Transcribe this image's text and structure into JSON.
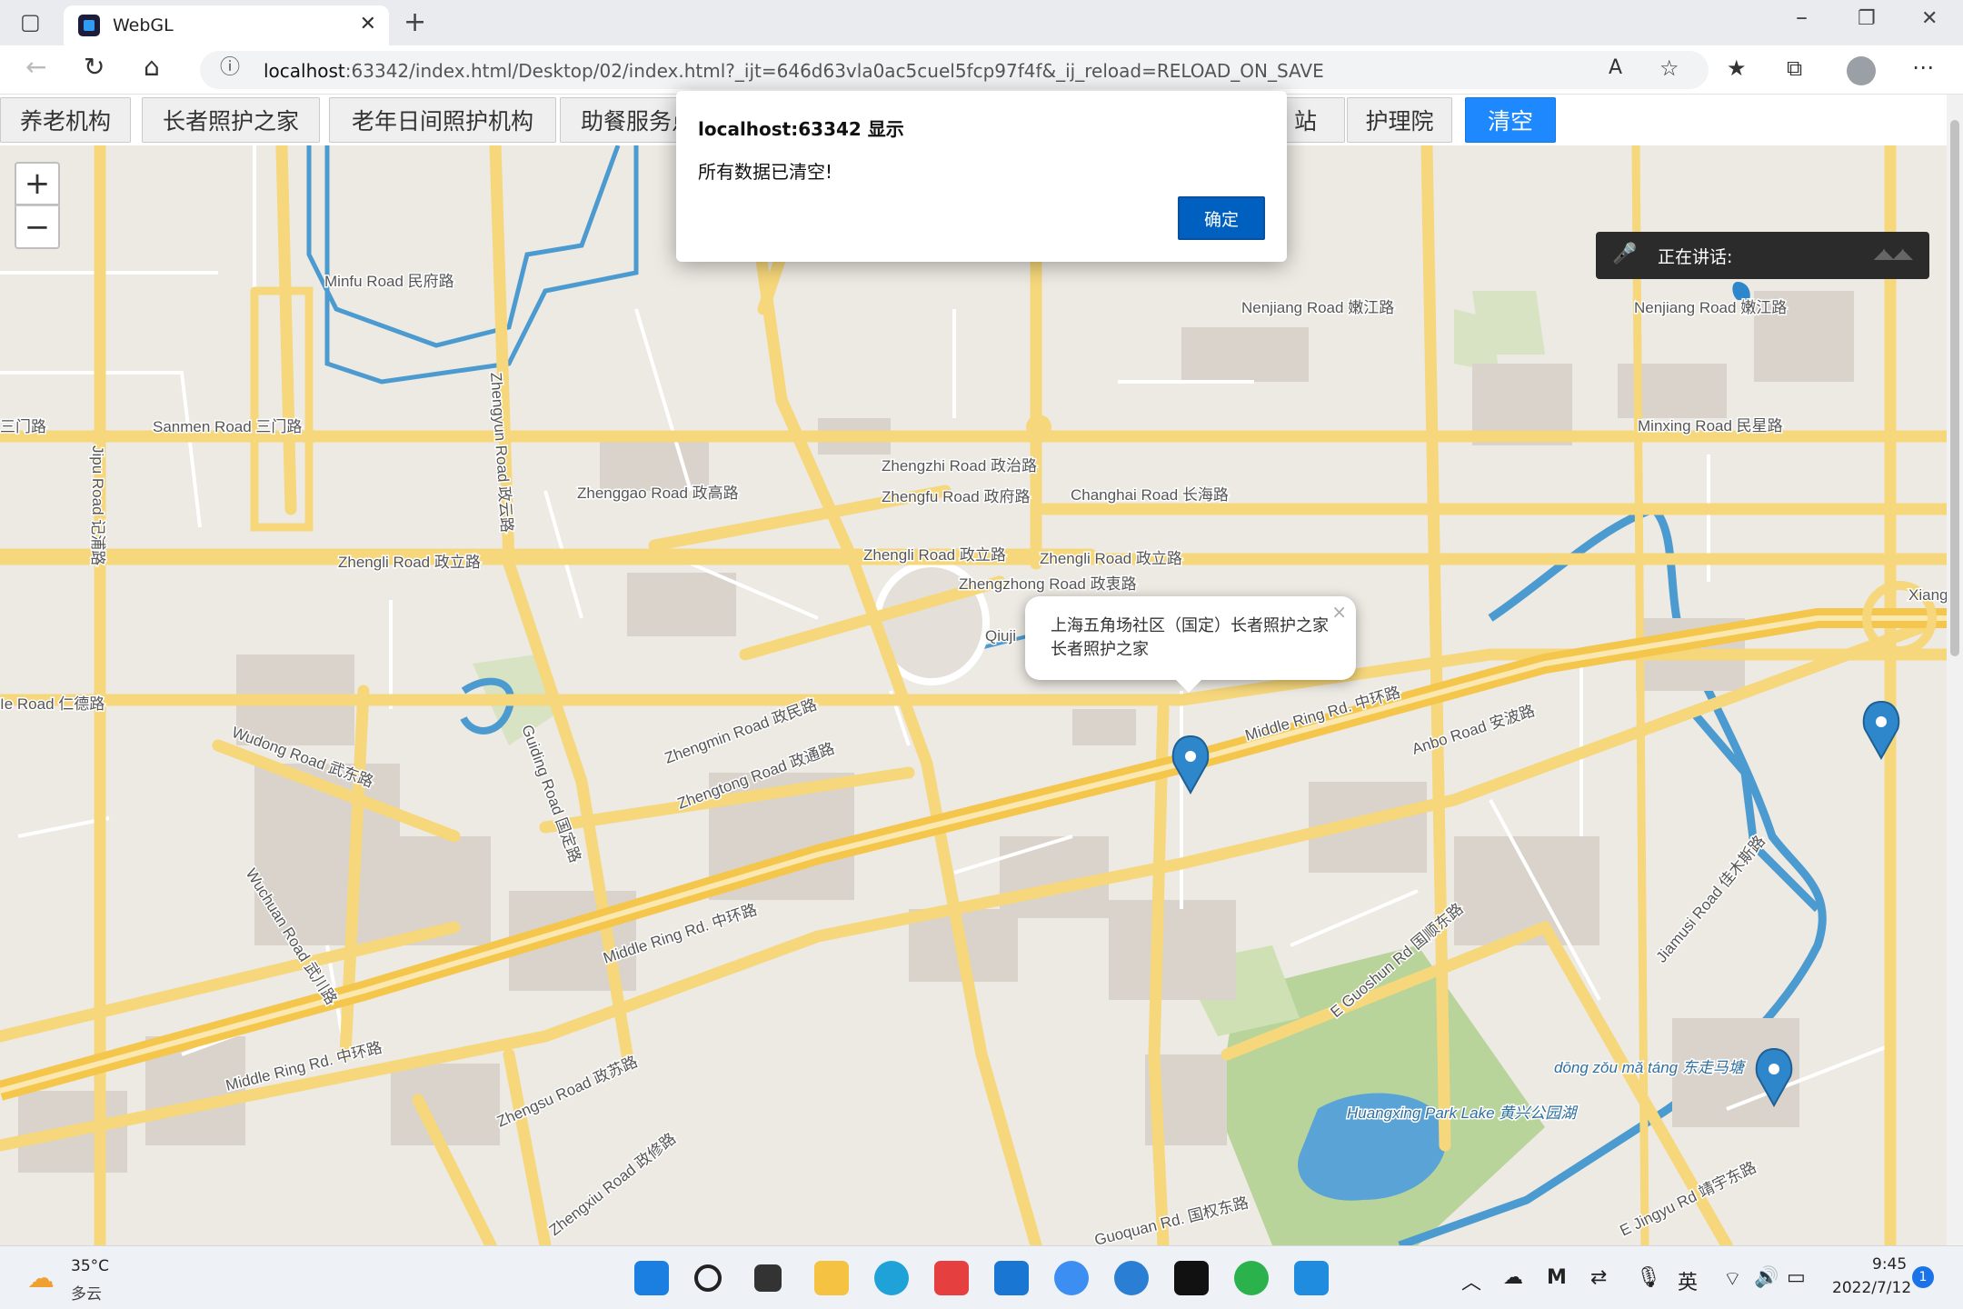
{
  "browser": {
    "tab_title": "WebGL",
    "url_host": "localhost",
    "url_rest": ":63342/index.html/Desktop/02/index.html?_ijt=646d63vla0ac5cuel5fcp97f4f&_ij_reload=RELOAD_ON_SAVE",
    "icons": [
      "sidebar-icon",
      "close-icon",
      "new-tab-icon",
      "minimize-icon",
      "restore-icon",
      "back-icon",
      "refresh-icon",
      "home-icon",
      "info-icon",
      "read-aloud-icon",
      "favorite-add-icon",
      "favorites-icon",
      "collections-icon",
      "profile-icon",
      "more-icon"
    ]
  },
  "buttons": [
    "养老机构",
    "长者照护之家",
    "老年日间照护机构",
    "助餐服务点",
    "",
    "护理院",
    "清空"
  ],
  "button_hidden_suffix": "站",
  "map": {
    "zoom_in": "+",
    "zoom_out": "−",
    "popup_line1": "上海五角场社区（国定）长者照护之家",
    "popup_line2": "长者照护之家",
    "popup_close": "×",
    "labels": [
      {
        "t": "Minfu Road 民府路"
      },
      {
        "t": "Sanmen Road 三门路"
      },
      {
        "t": "三门路"
      },
      {
        "t": "Zhengli Road 政立路"
      },
      {
        "t": "Zhenggao Road 政高路"
      },
      {
        "t": "Zhengzhi Road 政治路"
      },
      {
        "t": "Zhengfu Road 政府路"
      },
      {
        "t": "Changhai Road 长海路"
      },
      {
        "t": "Zhengli Road 政立路"
      },
      {
        "t": "Zhengli Road 政立路"
      },
      {
        "t": "Zhengzhong Road 政衷路"
      },
      {
        "t": "Nenjiang Road 嫩江路"
      },
      {
        "t": "Nenjiang Road 嫩江路"
      },
      {
        "t": "Minxing Road 民星路"
      },
      {
        "t": "Middle Ring Rd. 中环路"
      },
      {
        "t": "Anbo Road 安波路"
      },
      {
        "t": "Middle Ring Rd. 中环路"
      },
      {
        "t": "Middle Ring Rd. 中环路"
      },
      {
        "t": "Zhengmin Road 政民路"
      },
      {
        "t": "Zhengtong Road 政通路"
      },
      {
        "t": "Wudong Road 武东路"
      },
      {
        "t": "Huangxing Park Lake 黄兴公园湖"
      },
      {
        "t": "dōng zǒu mǎ táng 东走马塘"
      },
      {
        "t": "E Guoshun Rd 国顺东路"
      },
      {
        "t": "Jiamusi Road 佳木斯路"
      },
      {
        "t": "Guoquan Rd. 国权东路"
      },
      {
        "t": "E Jingyu Rd 靖宇东路"
      },
      {
        "t": "Zhengsu Road 政苏路"
      },
      {
        "t": "Zhengxiu Road 政修路"
      },
      {
        "t": "Wuchuan Road 武川路"
      },
      {
        "t": "Guiding Road 国定路"
      },
      {
        "t": "Zhengyun Road 政云路"
      },
      {
        "t": "Jipu Road 记浦路"
      },
      {
        "t": "Xiang"
      },
      {
        "t": "Ie Road 仁德路"
      },
      {
        "t": "Qiuji"
      }
    ]
  },
  "dialog": {
    "title": "localhost:63342 显示",
    "message": "所有数据已清空!",
    "ok": "确定"
  },
  "speaking": {
    "label": "正在讲话:"
  },
  "taskbar": {
    "temp": "35°C",
    "weather": "多云",
    "ime": "英",
    "time": "9:45",
    "date": "2022/7/12",
    "notif": "1"
  },
  "colors": {
    "primary_button": "#1e88ff",
    "road_major": "#f6d77b",
    "water": "#4b9bd0",
    "park": "#b9d49a",
    "marker": "#2e87cb"
  }
}
